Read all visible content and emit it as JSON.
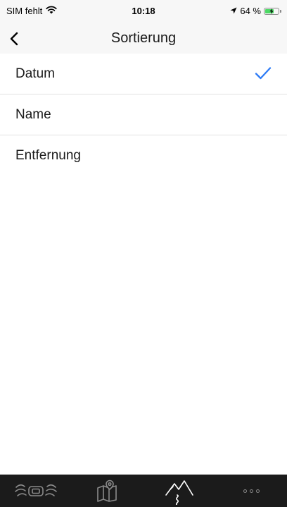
{
  "status_bar": {
    "carrier": "SIM fehlt",
    "time": "10:18",
    "battery_text": "64 %",
    "battery_level": 0.64
  },
  "nav": {
    "title": "Sortierung"
  },
  "sort_options": [
    {
      "label": "Datum",
      "selected": true
    },
    {
      "label": "Name",
      "selected": false
    },
    {
      "label": "Entfernung",
      "selected": false
    }
  ],
  "tab_bar": {
    "tabs": [
      "motorcycle-icon",
      "map-icon",
      "mountains-route-icon",
      "more-icon"
    ],
    "active_index": 2
  },
  "colors": {
    "accent": "#2f7cf6",
    "tab_bar_bg": "#1b1b1b",
    "tab_inactive": "#8a8a8a",
    "tab_active": "#ffffff"
  }
}
